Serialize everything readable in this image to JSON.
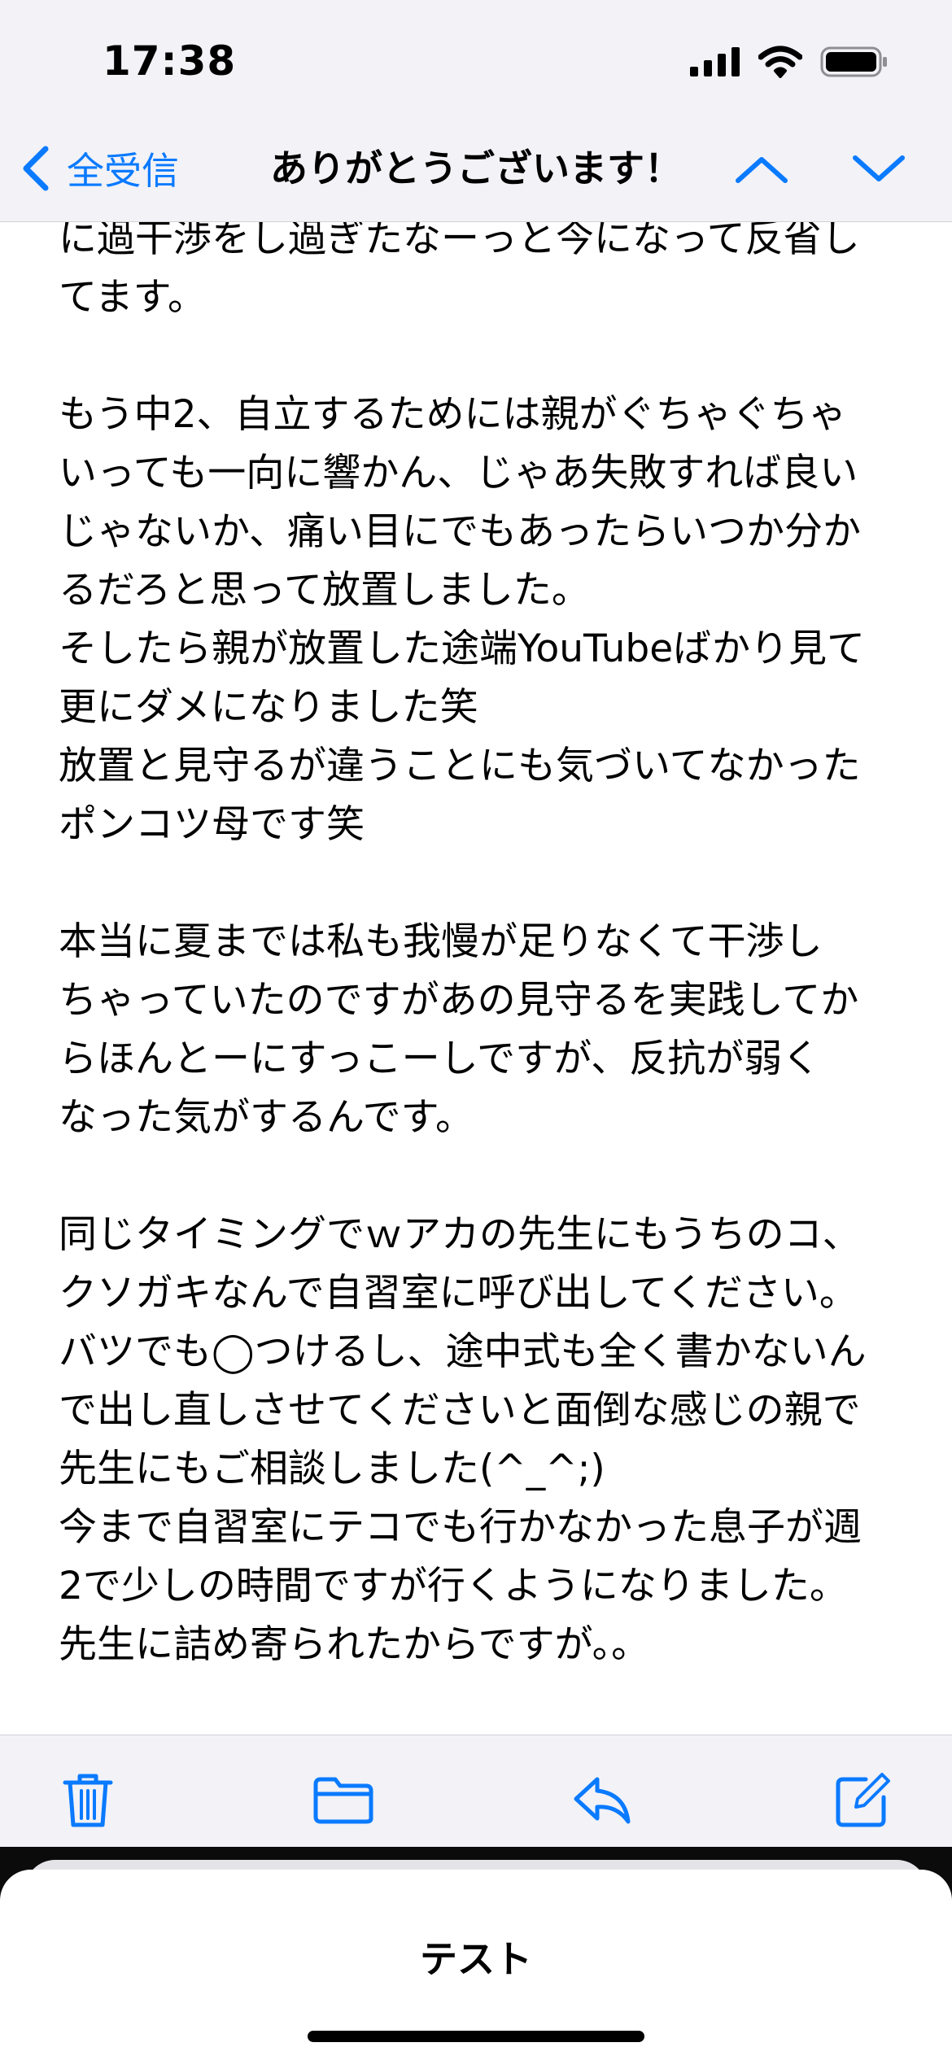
{
  "status_bar": {
    "time": "17:38"
  },
  "nav": {
    "back_label": "全受信",
    "title": "ありがとうございます！"
  },
  "message": {
    "paragraphs": [
      [
        "に過干渉をし過ぎたなーっと今になって反省し",
        "てます。"
      ],
      [
        "もう中2、自立するためには親がぐちゃぐちゃ",
        "いっても一向に響かん、じゃあ失敗すれば良い",
        "じゃないか、痛い目にでもあったらいつか分か",
        "るだろと思って放置しました。",
        "そしたら親が放置した途端YouTubeばかり見て",
        "更にダメになりました笑",
        "放置と見守るが違うことにも気づいてなかった",
        "ポンコツ母です笑"
      ],
      [
        "本当に夏までは私も我慢が足りなくて干渉し",
        "ちゃっていたのですがあの見守るを実践してか",
        "らほんとーにすっこーしですが、反抗が弱く",
        "なった気がするんです。"
      ],
      [
        "同じタイミングでｗアカの先生にもうちのコ、",
        "クソガキなんで自習室に呼び出してください。",
        "バツでも◯つけるし、途中式も全く書かないん",
        "で出し直しさせてくださいと面倒な感じの親で",
        "先生にもご相談しました(^_^;)",
        "今まで自習室にテコでも行かなかった息子が週",
        "2で少しの時間ですが行くようになりました。",
        "先生に詰め寄られたからですが。。"
      ]
    ]
  },
  "toolbar": {
    "icons": [
      "trash-icon",
      "folder-icon",
      "reply-icon",
      "compose-icon"
    ]
  },
  "sheet": {
    "title": "テスト"
  },
  "colors": {
    "accent": "#0a7aff",
    "bar_background": "#f2f2f7",
    "text": "#000000"
  }
}
